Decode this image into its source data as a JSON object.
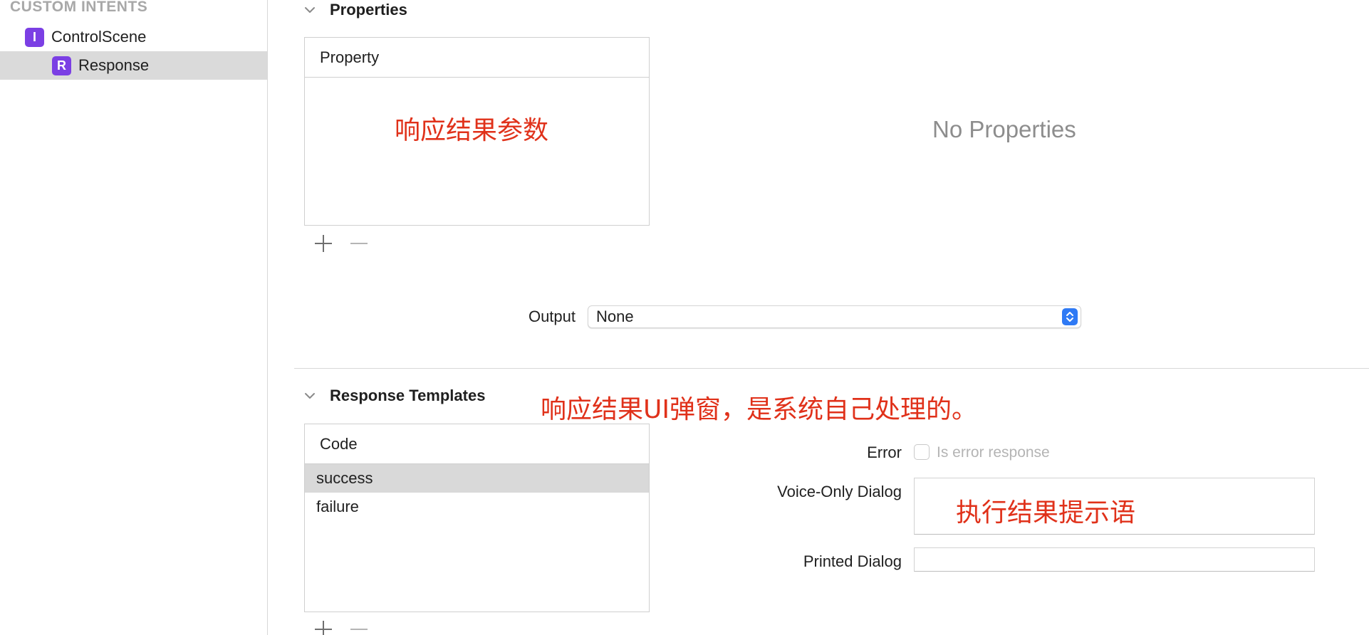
{
  "sidebar": {
    "section_header": "CUSTOM INTENTS",
    "items": [
      {
        "badge": "I",
        "label": "ControlScene"
      },
      {
        "badge": "R",
        "label": "Response"
      }
    ]
  },
  "properties_section": {
    "title": "Properties",
    "table_header": "Property",
    "annotation": "响应结果参数",
    "empty_text": "No Properties",
    "output_label": "Output",
    "output_value": "None"
  },
  "templates_section": {
    "title": "Response Templates",
    "annotation": "响应结果UI弹窗，是系统自己处理的。",
    "table_header": "Code",
    "rows": [
      "success",
      "failure"
    ],
    "error_label": "Error",
    "error_checkbox_label": "Is error response",
    "voice_label": "Voice-Only Dialog",
    "voice_annotation": "执行结果提示语",
    "printed_label": "Printed Dialog"
  },
  "colors": {
    "badge": "#7b3fe4",
    "annotation": "#e0311a",
    "accent": "#2f7af5",
    "selection": "#dadada"
  },
  "icons": [
    "chevron-down-icon",
    "plus-icon",
    "minus-icon",
    "popup-arrows-icon"
  ]
}
